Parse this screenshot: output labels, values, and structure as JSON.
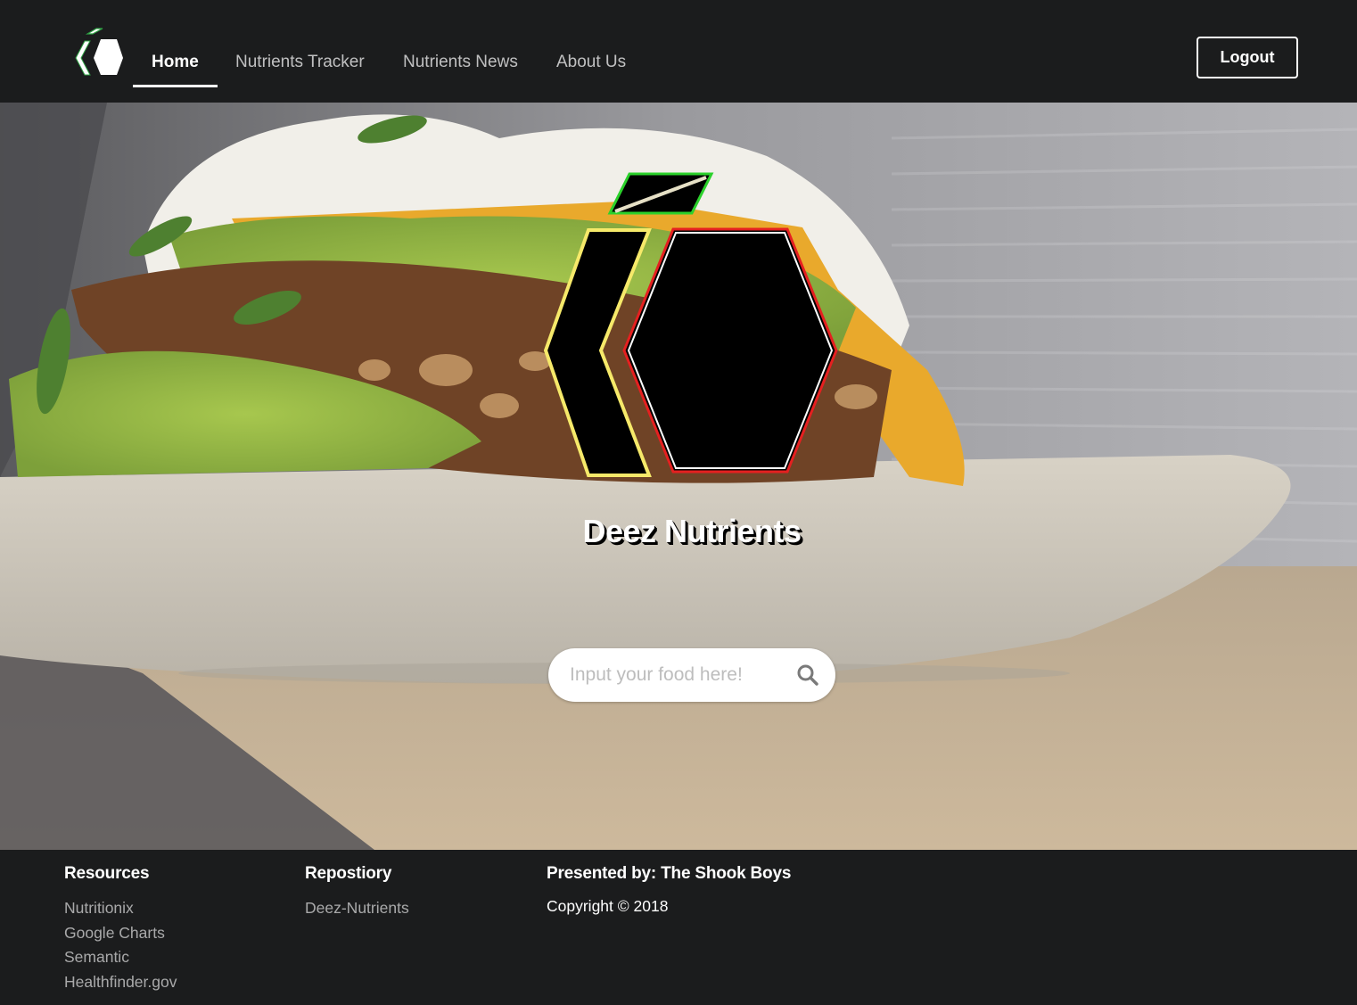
{
  "nav": {
    "items": [
      {
        "label": "Home",
        "active": true
      },
      {
        "label": "Nutrients Tracker",
        "active": false
      },
      {
        "label": "Nutrients News",
        "active": false
      },
      {
        "label": "About Us",
        "active": false
      }
    ],
    "logout_label": "Logout"
  },
  "hero": {
    "title": "Deez Nutrients",
    "search": {
      "placeholder": "Input your food here!",
      "value": ""
    }
  },
  "footer": {
    "resources": {
      "heading": "Resources",
      "links": [
        "Nutritionix",
        "Google Charts",
        "Semantic",
        "Healthfinder.gov"
      ]
    },
    "repository": {
      "heading": "Repostiory",
      "links": [
        "Deez-Nutrients"
      ]
    },
    "presented": {
      "heading": "Presented by: The Shook Boys",
      "copyright": "Copyright © 2018"
    }
  },
  "colors": {
    "nav_bg": "#1b1c1d",
    "logo_leaf": "#22cc22",
    "logo_chevron": "#f2e24a",
    "logo_hexagon": "#e02020"
  },
  "icons": {
    "brand": "hexagon-logo-icon",
    "search": "search-icon"
  }
}
